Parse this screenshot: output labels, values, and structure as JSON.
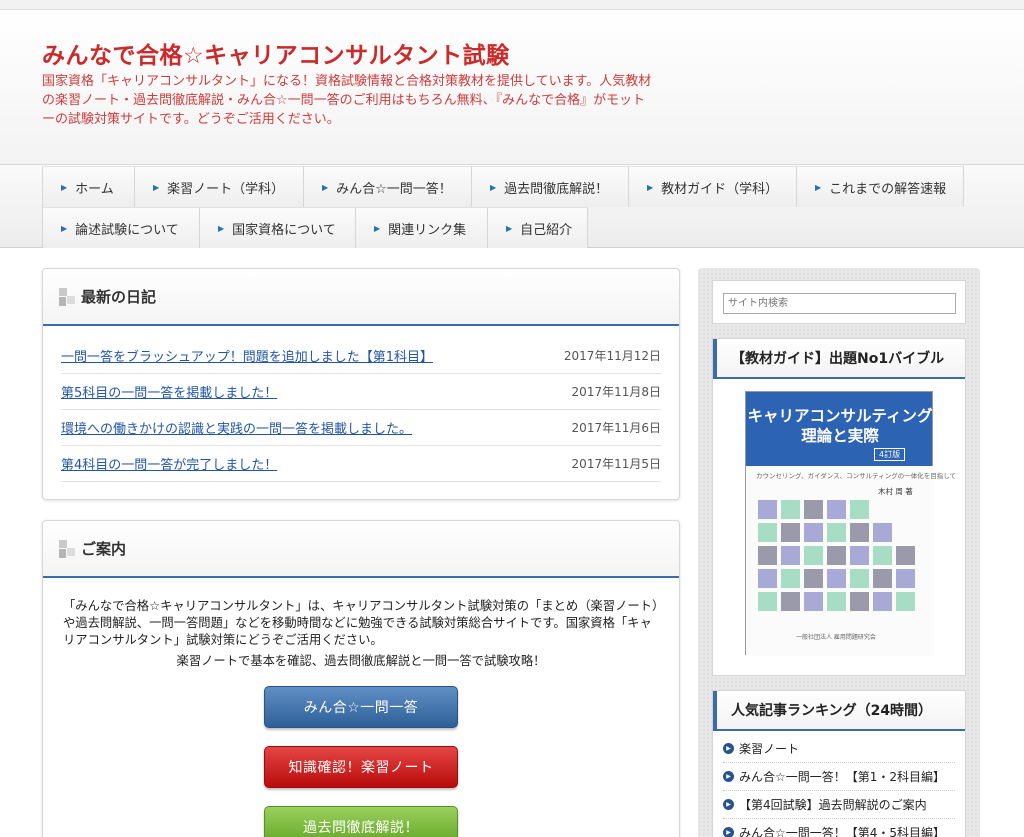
{
  "header": {
    "title": "みんなで合格☆キャリアコンサルタント試験",
    "description": "国家資格「キャリアコンサルタント」になる！資格試験情報と合格対策教材を提供しています。人気教材の楽習ノート・過去問徹底解説・みん合☆一問一答のご利用はもちろん無料、『みんなで合格』がモットーの試験対策サイトです。どうぞご活用ください。"
  },
  "nav": {
    "row1": [
      "ホーム",
      "楽習ノート（学科）",
      "みん合☆一問一答！",
      "過去問徹底解説！",
      "教材ガイド（学科）",
      "これまでの解答速報"
    ],
    "row2": [
      "論述試験について",
      "国家資格について",
      "関連リンク集",
      "自己紹介"
    ]
  },
  "latest": {
    "title": "最新の日記",
    "items": [
      {
        "text": "一問一答をブラッシュアップ！問題を追加しました【第1科目】",
        "date": "2017年11月12日"
      },
      {
        "text": "第5科目の一問一答を掲載しました！",
        "date": "2017年11月8日"
      },
      {
        "text": "環境への働きかけの認識と実践の一問一答を掲載しました。",
        "date": "2017年11月6日"
      },
      {
        "text": "第4科目の一問一答が完了しました！",
        "date": "2017年11月5日"
      }
    ]
  },
  "guide": {
    "title": "ご案内",
    "text": "「みんなで合格☆キャリアコンサルタント」は、キャリアコンサルタント試験対策の「まとめ（楽習ノート）や過去問解説、一問一答問題」などを移動時間などに勉強できる試験対策総合サイトです。国家資格「キャリアコンサルタント」試験対策にどうぞご活用ください。",
    "subtext": "楽習ノートで基本を確認、過去問徹底解説と一問一答で試験攻略！",
    "buttons": [
      "みん合☆一問一答",
      "知識確認！楽習ノート",
      "過去問徹底解説！"
    ]
  },
  "sidebar": {
    "search_placeholder": "サイト内検索",
    "book_box_title": "【教材ガイド】出題No1バイブル",
    "book": {
      "title_line1": "キャリアコンサルティング",
      "title_line2": "理論と実際",
      "edition": "4訂版",
      "subtitle": "カウンセリング、ガイダンス、コンサルティングの一体化を目指して",
      "author": "木村 周 著",
      "publisher": "一般社団法人 雇用問題研究会"
    },
    "ranking_title": "人気記事ランキング（24時間）",
    "ranking": [
      "楽習ノート",
      "みん合☆一問一答！【第1・2科目編】",
      "【第4回試験】過去問解説のご案内",
      "みん合☆一問一答！【第4・5科目編】"
    ]
  },
  "colors": {
    "title_red": "#cc2a2a",
    "accent_blue": "#3a6da8",
    "link_blue": "#2255aa",
    "btn_blue": "#2e5f98",
    "btn_red": "#b80c0c",
    "btn_green": "#5ea322"
  }
}
